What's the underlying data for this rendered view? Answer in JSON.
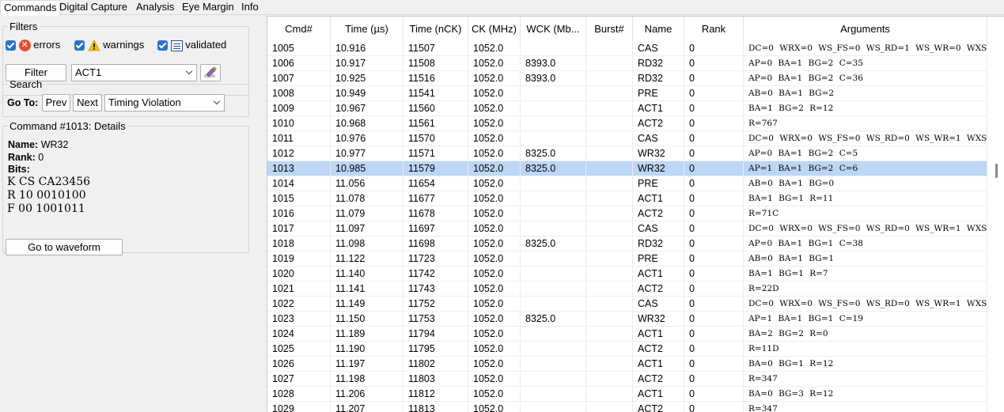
{
  "tabs": [
    "Commands",
    "Digital Capture",
    "Analysis",
    "Eye Margin",
    "Info"
  ],
  "filters": {
    "legend": "Filters",
    "errors_label": "errors",
    "warnings_label": "warnings",
    "validated_label": "validated",
    "filter_button": "Filter",
    "filter_value": "ACT1"
  },
  "search": {
    "legend": "Search",
    "goto_label": "Go To:",
    "prev_button": "Prev",
    "next_button": "Next",
    "target_value": "Timing Violation"
  },
  "details": {
    "legend": "Command #1013: Details",
    "name_label": "Name:",
    "name_value": "WR32",
    "rank_label": "Rank:",
    "rank_value": "0",
    "bits_label": "Bits:",
    "bits_lines": [
      "K CS CA23456",
      "R 10 0010100",
      "F 00 1001011"
    ],
    "waveform_button": "Go to waveform"
  },
  "table": {
    "columns": [
      "Cmd#",
      "Time (µs)",
      "Time (nCK)",
      "CK (MHz)",
      "WCK (Mb...",
      "Burst#",
      "Name",
      "Rank",
      "Arguments"
    ],
    "selected_cmd": "1013",
    "rows": [
      [
        "1005",
        "10.916",
        "11507",
        "1052.0",
        "",
        "",
        "CAS",
        "0",
        "DC=0 WRX=0 WS_FS=0 WS_RD=1 WS_WR=0 WXSA=0 WXS"
      ],
      [
        "1006",
        "10.917",
        "11508",
        "1052.0",
        "8393.0",
        "",
        "RD32",
        "0",
        "AP=0 BA=1 BG=2 C=35"
      ],
      [
        "1007",
        "10.925",
        "11516",
        "1052.0",
        "8393.0",
        "",
        "RD32",
        "0",
        "AP=0 BA=1 BG=2 C=36"
      ],
      [
        "1008",
        "10.949",
        "11541",
        "1052.0",
        "",
        "",
        "PRE",
        "0",
        "AB=0 BA=1 BG=2"
      ],
      [
        "1009",
        "10.967",
        "11560",
        "1052.0",
        "",
        "",
        "ACT1",
        "0",
        "BA=1 BG=2 R=12"
      ],
      [
        "1010",
        "10.968",
        "11561",
        "1052.0",
        "",
        "",
        "ACT2",
        "0",
        "R=767"
      ],
      [
        "1011",
        "10.976",
        "11570",
        "1052.0",
        "",
        "",
        "CAS",
        "0",
        "DC=0 WRX=0 WS_FS=0 WS_RD=0 WS_WR=1 WXSA=0 WXS"
      ],
      [
        "1012",
        "10.977",
        "11571",
        "1052.0",
        "8325.0",
        "",
        "WR32",
        "0",
        "AP=0 BA=1 BG=2 C=5"
      ],
      [
        "1013",
        "10.985",
        "11579",
        "1052.0",
        "8325.0",
        "",
        "WR32",
        "0",
        "AP=1 BA=1 BG=2 C=6"
      ],
      [
        "1014",
        "11.056",
        "11654",
        "1052.0",
        "",
        "",
        "PRE",
        "0",
        "AB=0 BA=1 BG=0"
      ],
      [
        "1015",
        "11.078",
        "11677",
        "1052.0",
        "",
        "",
        "ACT1",
        "0",
        "BA=1 BG=1 R=11"
      ],
      [
        "1016",
        "11.079",
        "11678",
        "1052.0",
        "",
        "",
        "ACT2",
        "0",
        "R=71C"
      ],
      [
        "1017",
        "11.097",
        "11697",
        "1052.0",
        "",
        "",
        "CAS",
        "0",
        "DC=0 WRX=0 WS_FS=0 WS_RD=0 WS_WR=1 WXSA=0 WXS"
      ],
      [
        "1018",
        "11.098",
        "11698",
        "1052.0",
        "8325.0",
        "",
        "RD32",
        "0",
        "AP=0 BA=1 BG=1 C=38"
      ],
      [
        "1019",
        "11.122",
        "11723",
        "1052.0",
        "",
        "",
        "PRE",
        "0",
        "AB=0 BA=1 BG=1"
      ],
      [
        "1020",
        "11.140",
        "11742",
        "1052.0",
        "",
        "",
        "ACT1",
        "0",
        "BA=1 BG=1 R=7"
      ],
      [
        "1021",
        "11.141",
        "11743",
        "1052.0",
        "",
        "",
        "ACT2",
        "0",
        "R=22D"
      ],
      [
        "1022",
        "11.149",
        "11752",
        "1052.0",
        "",
        "",
        "CAS",
        "0",
        "DC=0 WRX=0 WS_FS=0 WS_RD=0 WS_WR=1 WXSA=0 WXS"
      ],
      [
        "1023",
        "11.150",
        "11753",
        "1052.0",
        "8325.0",
        "",
        "WR32",
        "0",
        "AP=1 BA=1 BG=1 C=19"
      ],
      [
        "1024",
        "11.189",
        "11794",
        "1052.0",
        "",
        "",
        "ACT1",
        "0",
        "BA=2 BG=2 R=0"
      ],
      [
        "1025",
        "11.190",
        "11795",
        "1052.0",
        "",
        "",
        "ACT2",
        "0",
        "R=11D"
      ],
      [
        "1026",
        "11.197",
        "11802",
        "1052.0",
        "",
        "",
        "ACT1",
        "0",
        "BA=0 BG=1 R=12"
      ],
      [
        "1027",
        "11.198",
        "11803",
        "1052.0",
        "",
        "",
        "ACT2",
        "0",
        "R=347"
      ],
      [
        "1028",
        "11.206",
        "11812",
        "1052.0",
        "",
        "",
        "ACT1",
        "0",
        "BA=0 BG=3 R=12"
      ],
      [
        "1029",
        "11.207",
        "11813",
        "1052.0",
        "",
        "",
        "ACT2",
        "0",
        "R=347"
      ]
    ]
  }
}
